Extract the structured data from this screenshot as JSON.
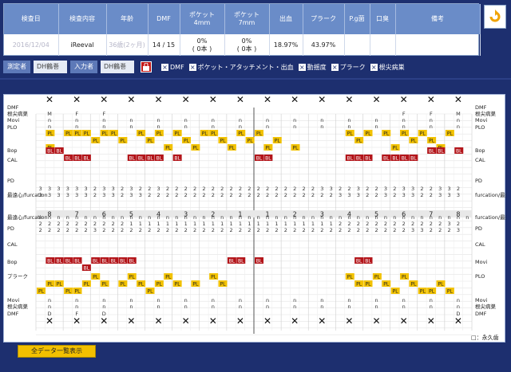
{
  "summary": {
    "headers": [
      "検査日",
      "検査内容",
      "年齢",
      "DMF",
      "ポケット\n4mm",
      "ポケット\n7mm",
      "出血",
      "プラーク",
      "P.g菌",
      "口臭",
      "備考"
    ],
    "values": [
      "2016/12/04",
      "iReeval",
      "36歳(2ヶ月)",
      "14 / 15",
      "0%\n( 0本 )",
      "0%\n( 0本 )",
      "18.97%",
      "43.97%",
      "",
      "",
      ""
    ]
  },
  "options": {
    "measurer_label": "測定者",
    "measurer_value": "DH鶴巻",
    "input_label": "入力者",
    "input_value": "DH鶴巻",
    "checks": [
      "DMF",
      "ポケット・アタッチメント・出血",
      "動揺度",
      "プラーク",
      "根尖病巣"
    ]
  },
  "chart": {
    "upper_left_labels": [
      "DMF",
      "根尖病巣",
      "Movi",
      "PLO",
      "Bop",
      "CAL",
      "PD",
      "最遠心/furcation"
    ],
    "upper_right_labels": [
      "DMF",
      "根尖病巣",
      "Movi",
      "PLO",
      "Bop",
      "CAL",
      "PD",
      "furcation/最遠心"
    ],
    "lower_left_labels": [
      "最遠心/furcation",
      "PD",
      "CAL",
      "Bop",
      "プラーク",
      "Movi",
      "根尖病巣",
      "DMF"
    ],
    "lower_right_labels": [
      "furcation/最遠心",
      "PD",
      "CAL",
      "Movi",
      "PLO",
      "Movi",
      "根尖病巣",
      "DMF"
    ],
    "tooth_numbers": [
      "8",
      "7",
      "6",
      "5",
      "4",
      "3",
      "2",
      "1",
      "1",
      "2",
      "3",
      "4",
      "5",
      "6",
      "7",
      "8"
    ],
    "upper_dmf": [
      "M",
      "F",
      "F",
      "",
      "",
      "",
      "",
      "",
      "",
      "",
      "",
      "",
      "",
      "F",
      "F",
      "M"
    ],
    "lower_dmf": [
      "D",
      "F",
      "D",
      "",
      "",
      "",
      "",
      "",
      "",
      "",
      "",
      "",
      "",
      "",
      "",
      "D"
    ],
    "upper_pd_top": "3 3 3 3 3 3 2 3 3 2 3 2 2 3 2 2 2 2 2 2 2 2 2 2 2 2 2 2 2 2 2 3 3 2 2 3 2 2 3 2 3 3 2 2 3 3 2",
    "upper_pd_bot": "3 3 3 3 3 3 2 3 3 2 3 3 2 2 2 2 2 2 2 2 2 2 2 2 2 2 2 2 2 2 2 2 2 3 3 3 2 2 3 2 3 3 2 2 3 3 3",
    "lower_pd_top": "2 2 2 2 2 2 2 2 2 2 1 1 1 1 1 1 1 1 1 1 1 1 1 1 1 1 1 1 1 1 1 1 1 2 2 2 2 2 2 2 2 2 2 2 2 3 2",
    "lower_pd_bot": "2 2 2 2 2 2 3 2 2 2 2 2 2 2 2 2 2 2 2 2 2 2 2 2 2 2 2 2 2 2 2 2 2 2 2 2 2 2 2 2 2 3 3 2 2 2 3",
    "pl_color": "#f2c200",
    "bl_color": "#b3151a",
    "legend": "□：永久歯"
  },
  "footer": {
    "all_data_button": "全データ一覧表示"
  }
}
